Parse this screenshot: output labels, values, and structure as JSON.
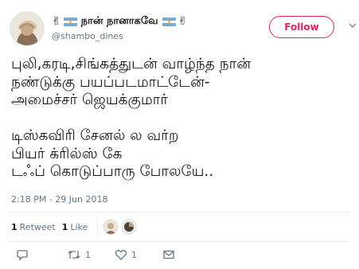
{
  "user": {
    "display_name": "நான் நானாகவே",
    "handle": "@shambo_dines",
    "emoji_v": "✌",
    "flag_icon": "argentina-flag-icon"
  },
  "follow_label": "Follow",
  "tweet": {
    "text": "புலி,கரடி,சிங்கத்துடன் வாழ்ந்த நான்\nநண்டுக்கு பயப்படமாட்டேன்-\nஅமைச்சர் ஜெயக்குமார்\n\nடிஸ்கவிரி சேனல் ல வர்ற\nபியர் க்ரில்ஸ் கே\nடஃப் கொடுப்பாரு போலயே..",
    "timestamp": "2:18 PM - 29 Jun 2018"
  },
  "stats": {
    "retweets_count": "1",
    "retweets_label": "Retweet",
    "likes_count": "1",
    "likes_label": "Like"
  },
  "actions": {
    "reply_icon": "reply-icon",
    "retweet_icon": "retweet-icon",
    "retweet_count": "1",
    "like_icon": "heart-icon",
    "like_count": "1",
    "dm_icon": "mail-icon"
  },
  "colors": {
    "accent": "#e0245e",
    "muted": "#657786",
    "text": "#14171a",
    "border": "#e6ecf0"
  }
}
